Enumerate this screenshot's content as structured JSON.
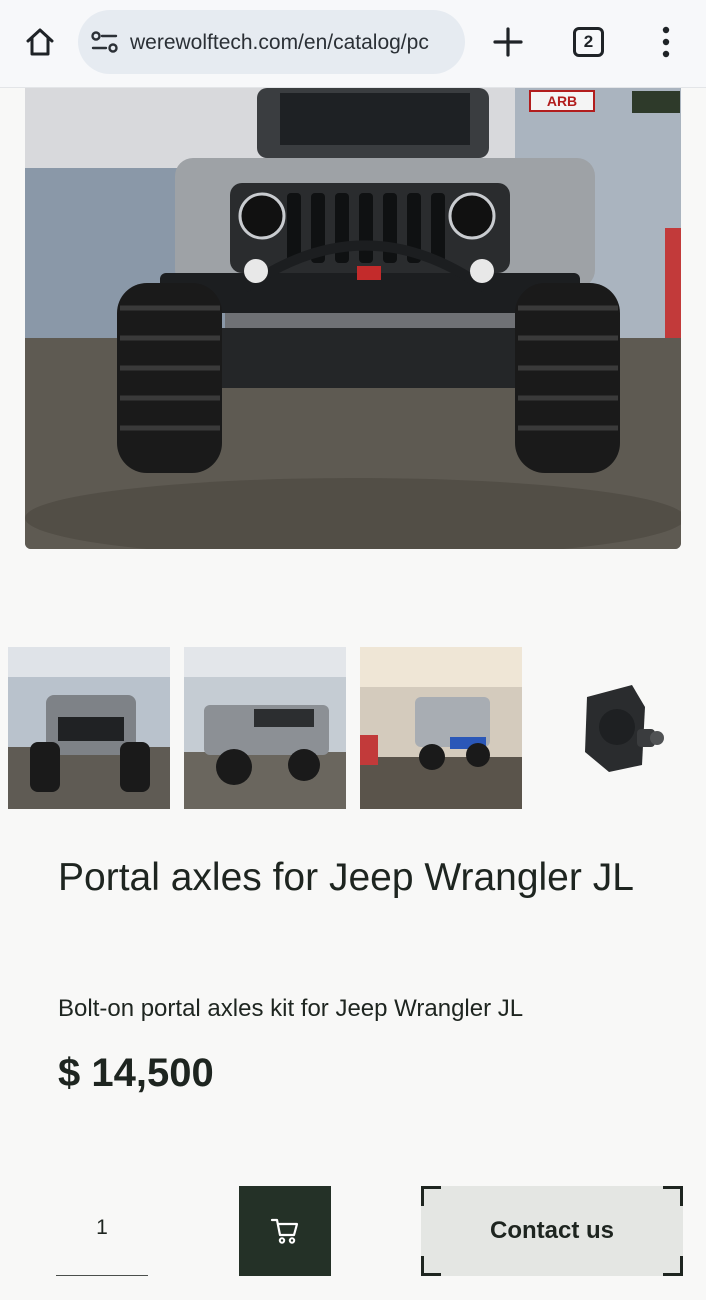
{
  "browser": {
    "url": "werewolftech.com/en/catalog/pc",
    "tab_count": "2",
    "icons": [
      "home-icon",
      "site-settings-icon",
      "new-tab-icon",
      "tab-switcher-icon",
      "more-menu-icon"
    ]
  },
  "gallery": {
    "main_image": "jeep-wrangler-front-view-photo",
    "thumbnails": [
      "jeep-front-view-thumbnail",
      "jeep-side-view-thumbnail",
      "jeep-rear-view-thumbnail",
      "portal-axle-gearbox-thumbnail"
    ]
  },
  "product": {
    "title": "Portal axles for Jeep Wrangler JL",
    "subtitle": "Bolt-on portal axles kit for Jeep Wrangler JL",
    "price": "$ 14,500",
    "quantity": "1",
    "contact_label": "Contact us"
  },
  "colors": {
    "cart_button": "#243127",
    "contact_button": "#e4e6e3",
    "text": "#1e2520"
  }
}
